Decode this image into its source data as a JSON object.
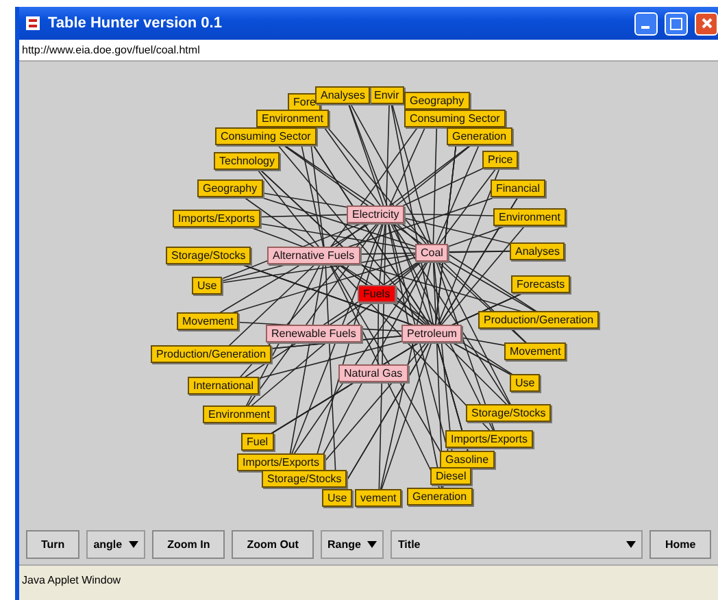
{
  "window": {
    "title": "Table Hunter version 0.1"
  },
  "address": "http://www.eia.doe.gov/fuel/coal.html",
  "graph": {
    "nodes": [
      {
        "label": "Fore",
        "kind": "topic"
      },
      {
        "label": "Envir",
        "kind": "topic"
      },
      {
        "label": "Environment",
        "kind": "topic"
      },
      {
        "label": "Analyses",
        "kind": "topic"
      },
      {
        "label": "Geography",
        "kind": "topic"
      },
      {
        "label": "Consuming Sector",
        "kind": "topic"
      },
      {
        "label": "Generation",
        "kind": "topic"
      },
      {
        "label": "Price",
        "kind": "topic"
      },
      {
        "label": "Financial",
        "kind": "topic"
      },
      {
        "label": "Environment",
        "kind": "topic"
      },
      {
        "label": "Analyses",
        "kind": "topic"
      },
      {
        "label": "Forecasts",
        "kind": "topic"
      },
      {
        "label": "Production/Generation",
        "kind": "topic"
      },
      {
        "label": "Movement",
        "kind": "topic"
      },
      {
        "label": "Use",
        "kind": "topic"
      },
      {
        "label": "Storage/Stocks",
        "kind": "topic"
      },
      {
        "label": "Imports/Exports",
        "kind": "topic"
      },
      {
        "label": "Gasoline",
        "kind": "topic"
      },
      {
        "label": "Diesel",
        "kind": "topic"
      },
      {
        "label": "Consuming Sector",
        "kind": "topic"
      },
      {
        "label": "Technology",
        "kind": "topic"
      },
      {
        "label": "Geography",
        "kind": "topic"
      },
      {
        "label": "Imports/Exports",
        "kind": "topic"
      },
      {
        "label": "Storage/Stocks",
        "kind": "topic"
      },
      {
        "label": "Use",
        "kind": "topic"
      },
      {
        "label": "Movement",
        "kind": "topic"
      },
      {
        "label": "Production/Generation",
        "kind": "topic"
      },
      {
        "label": "International",
        "kind": "topic"
      },
      {
        "label": "Environment",
        "kind": "topic"
      },
      {
        "label": "Fuel",
        "kind": "topic"
      },
      {
        "label": "Imports/Exports",
        "kind": "topic"
      },
      {
        "label": "Storage/Stocks",
        "kind": "topic"
      },
      {
        "label": "Use",
        "kind": "topic"
      },
      {
        "label": "vement",
        "kind": "topic"
      },
      {
        "label": "Generation",
        "kind": "topic"
      },
      {
        "label": "Electricity",
        "kind": "category"
      },
      {
        "label": "Alternative Fuels",
        "kind": "category"
      },
      {
        "label": "Coal",
        "kind": "category"
      },
      {
        "label": "Fuels",
        "kind": "root"
      },
      {
        "label": "Renewable Fuels",
        "kind": "category"
      },
      {
        "label": "Petroleum",
        "kind": "category"
      },
      {
        "label": "Natural Gas",
        "kind": "category"
      }
    ]
  },
  "toolbar": [
    {
      "kind": "button",
      "label": "Turn"
    },
    {
      "kind": "dropdown",
      "label": "angle"
    },
    {
      "kind": "button",
      "label": "Zoom In"
    },
    {
      "kind": "button",
      "label": "Zoom Out"
    },
    {
      "kind": "dropdown",
      "label": "Range"
    },
    {
      "kind": "wide-dropdown",
      "label": "Title"
    },
    {
      "kind": "button",
      "label": "Home"
    }
  ],
  "status_bar": "Java Applet Window"
}
